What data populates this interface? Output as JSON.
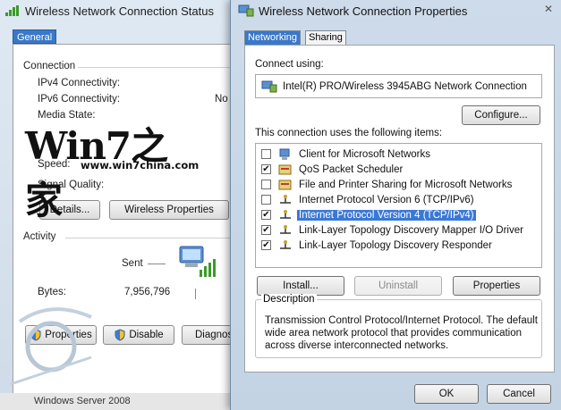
{
  "status_window": {
    "title": "Wireless Network Connection Status",
    "tab": "General",
    "connection_heading": "Connection",
    "ipv4_label": "IPv4 Connectivity:",
    "ipv6_label": "IPv6 Connectivity:",
    "ipv6_value_partial": "No",
    "media_state_label": "Media State:",
    "speed_label": "Speed:",
    "signal_label": "Signal Quality:",
    "details_button": "Details...",
    "wireless_properties_button": "Wireless Properties",
    "activity_heading": "Activity",
    "sent_label": "Sent",
    "bytes_label": "Bytes:",
    "bytes_sent": "7,956,796",
    "properties_button": "Properties",
    "disable_button": "Disable",
    "diagnose_button_partial": "Diagnos",
    "watermark_text": "Win7之家",
    "watermark_url": "www.win7china.com",
    "taskbar_text": "Windows Server 2008"
  },
  "dialog": {
    "title": "Wireless Network Connection Properties",
    "close_glyph": "✕",
    "tabs": [
      {
        "label": "Networking",
        "active": true
      },
      {
        "label": "Sharing",
        "active": false
      }
    ],
    "connect_using_label": "Connect using:",
    "adapter_name": "Intel(R) PRO/Wireless 3945ABG Network Connection",
    "configure_button": "Configure...",
    "items_heading": "This connection uses the following items:",
    "items": [
      {
        "label": "Client for Microsoft Networks",
        "checked": false,
        "selected": false,
        "icon": "network-client-icon"
      },
      {
        "label": "QoS Packet Scheduler",
        "checked": true,
        "selected": false,
        "icon": "service-icon"
      },
      {
        "label": "File and Printer Sharing for Microsoft Networks",
        "checked": false,
        "selected": false,
        "icon": "service-icon"
      },
      {
        "label": "Internet Protocol Version 6 (TCP/IPv6)",
        "checked": false,
        "selected": false,
        "icon": "protocol-icon"
      },
      {
        "label": "Internet Protocol Version 4 (TCP/IPv4)",
        "checked": true,
        "selected": true,
        "icon": "protocol-icon"
      },
      {
        "label": "Link-Layer Topology Discovery Mapper I/O Driver",
        "checked": true,
        "selected": false,
        "icon": "protocol-icon"
      },
      {
        "label": "Link-Layer Topology Discovery Responder",
        "checked": true,
        "selected": false,
        "icon": "protocol-icon"
      }
    ],
    "install_button": "Install...",
    "uninstall_button": "Uninstall",
    "properties_button": "Properties",
    "description_legend": "Description",
    "description_text": "Transmission Control Protocol/Internet Protocol. The default wide area network protocol that provides communication across diverse interconnected networks.",
    "ok_button": "OK",
    "cancel_button": "Cancel"
  },
  "colors": {
    "selection": "#3a78d8",
    "tab_active": "#3a78c8",
    "title_bar": "#cddbea"
  }
}
